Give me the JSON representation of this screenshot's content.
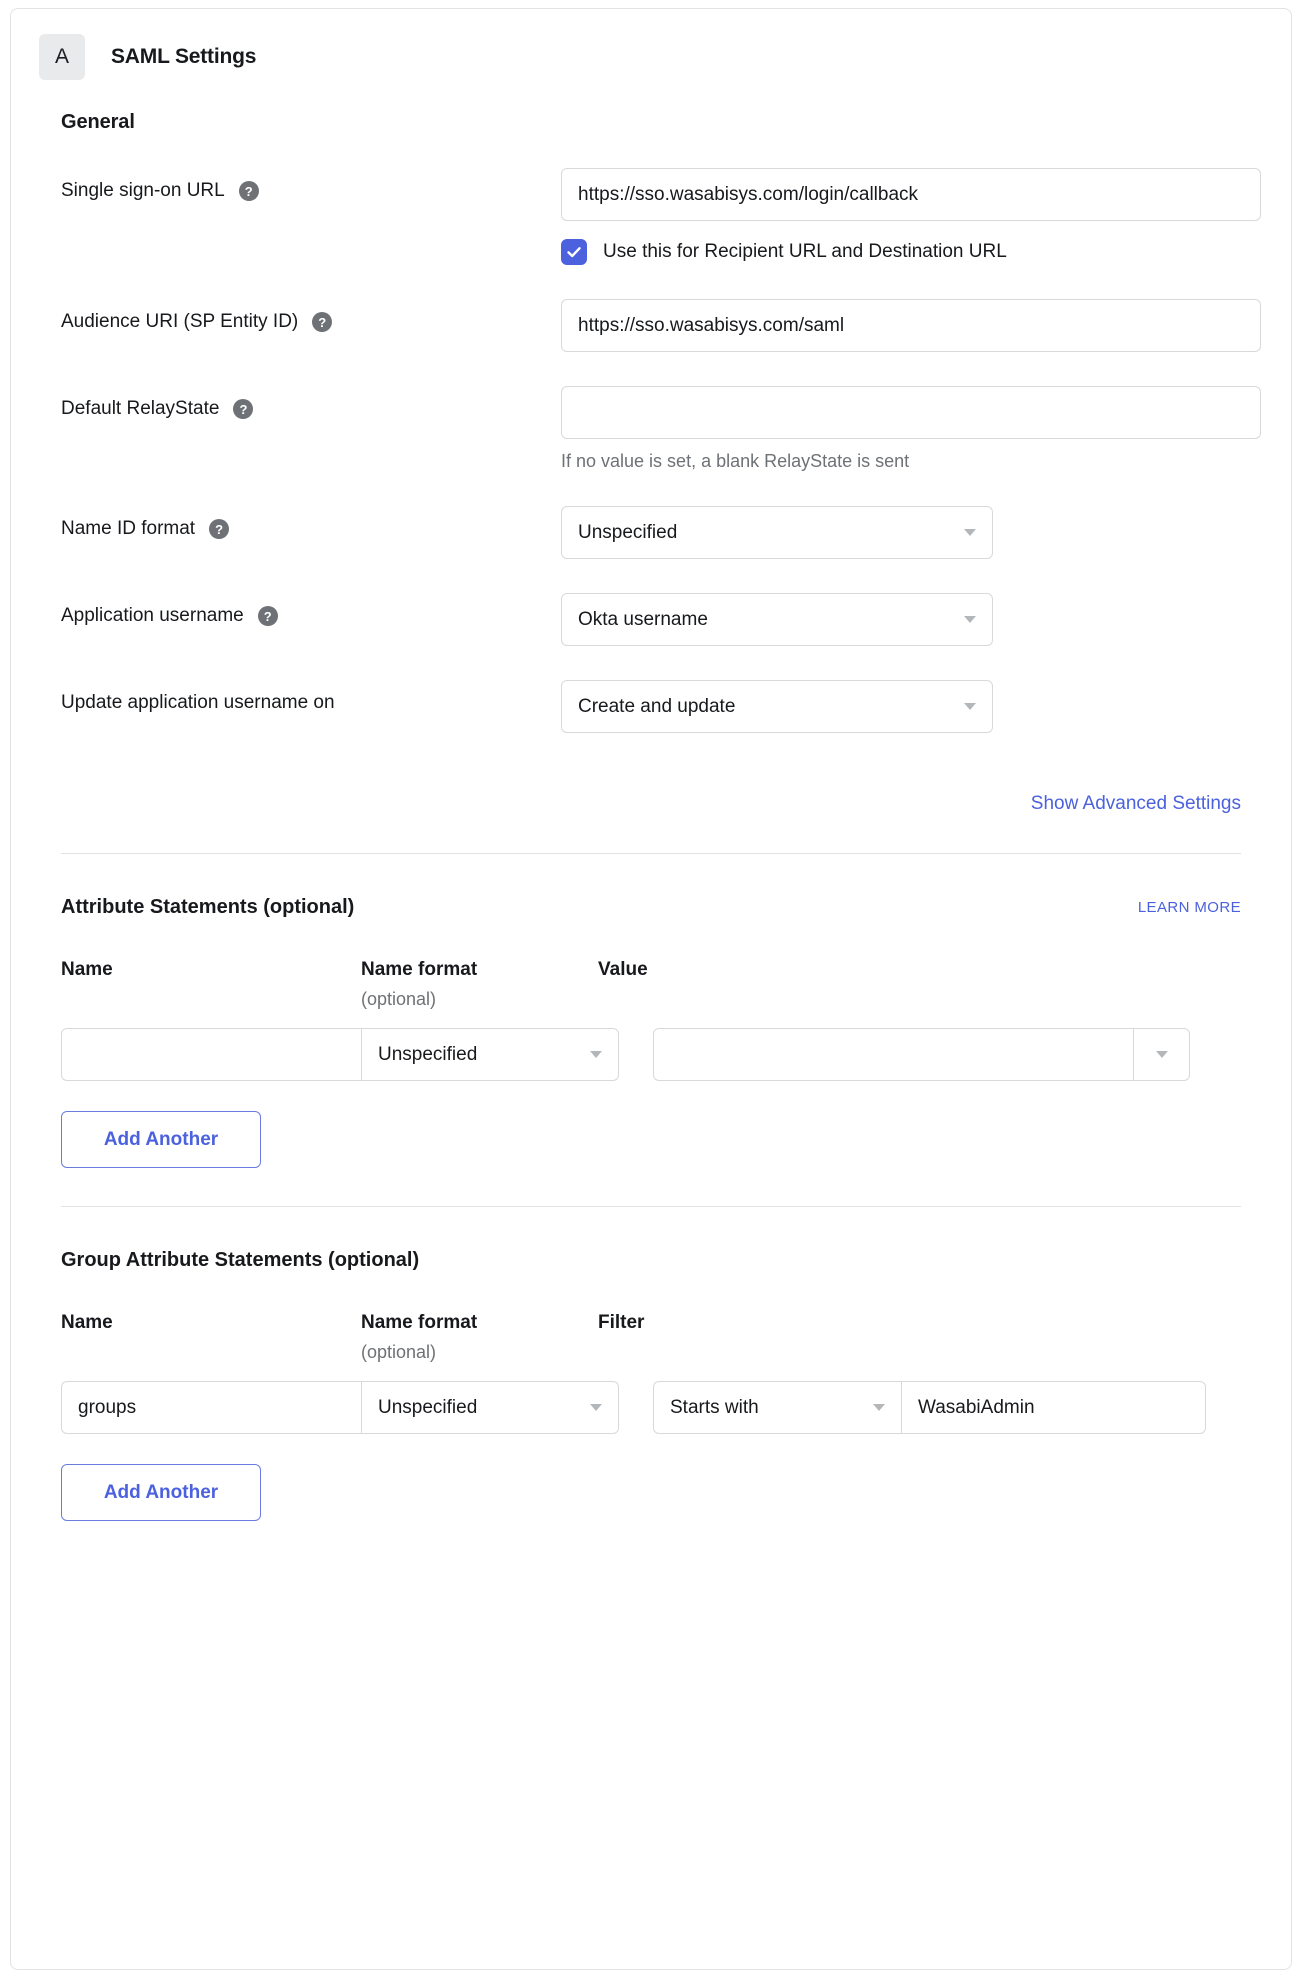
{
  "header": {
    "app_badge_letter": "A",
    "title": "SAML Settings"
  },
  "general": {
    "section_title": "General",
    "sso_url": {
      "label": "Single sign-on URL",
      "help_icon": "question-mark-icon",
      "value": "https://sso.wasabisys.com/login/callback",
      "checkbox_label": "Use this for Recipient URL and Destination URL",
      "checkbox_checked": true
    },
    "audience_uri": {
      "label": "Audience URI (SP Entity ID)",
      "help_icon": "question-mark-icon",
      "value": "https://sso.wasabisys.com/saml"
    },
    "default_relaystate": {
      "label": "Default RelayState",
      "help_icon": "question-mark-icon",
      "value": "",
      "hint": "If no value is set, a blank RelayState is sent"
    },
    "name_id_format": {
      "label": "Name ID format",
      "help_icon": "question-mark-icon",
      "selected": "Unspecified"
    },
    "application_username": {
      "label": "Application username",
      "help_icon": "question-mark-icon",
      "selected": "Okta username"
    },
    "update_application_username_on": {
      "label": "Update application username on",
      "selected": "Create and update"
    },
    "advanced_link": "Show Advanced Settings"
  },
  "attribute_statements": {
    "title": "Attribute Statements (optional)",
    "learn_more": "LEARN MORE",
    "columns": {
      "name": "Name",
      "name_format": "Name format",
      "name_format_sub": "(optional)",
      "value": "Value"
    },
    "rows": [
      {
        "name": "",
        "name_format": "Unspecified",
        "value": ""
      }
    ],
    "add_another": "Add Another"
  },
  "group_attribute_statements": {
    "title": "Group Attribute Statements (optional)",
    "columns": {
      "name": "Name",
      "name_format": "Name format",
      "name_format_sub": "(optional)",
      "filter": "Filter"
    },
    "rows": [
      {
        "name": "groups",
        "name_format": "Unspecified",
        "filter_type": "Starts with",
        "filter_value": "WasabiAdmin"
      }
    ],
    "add_another": "Add Another"
  },
  "colors": {
    "accent_blue": "#4b61dd",
    "text_primary": "#17191c",
    "text_muted": "#6e7175",
    "border": "#d7d9dc"
  }
}
